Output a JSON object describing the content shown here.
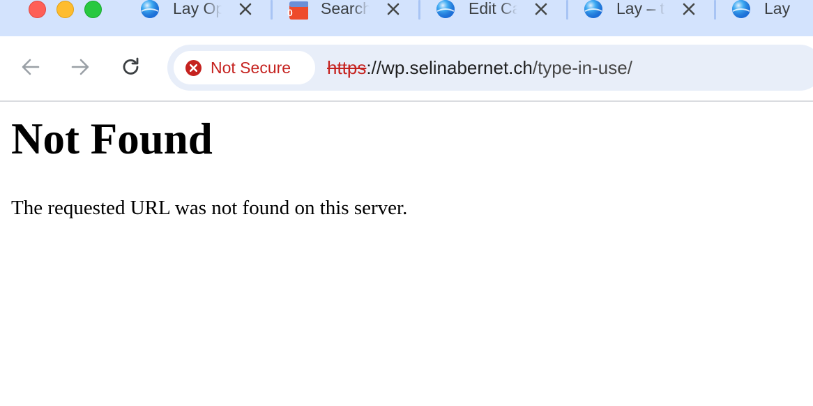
{
  "window": {
    "controls": [
      "close",
      "minimize",
      "maximize"
    ]
  },
  "tabs": [
    {
      "title": "Lay Op",
      "favicon": "globe-icon",
      "close_icon": "close-icon"
    },
    {
      "title": "Search",
      "favicon": "badge-app-icon",
      "close_icon": "close-icon"
    },
    {
      "title": "Edit Ca",
      "favicon": "globe-icon",
      "close_icon": "close-icon"
    },
    {
      "title": "Lay – t",
      "favicon": "globe-icon",
      "close_icon": "close-icon"
    },
    {
      "title": "Lay",
      "favicon": "globe-icon"
    }
  ],
  "toolbar": {
    "back_icon": "arrow-left-icon",
    "forward_icon": "arrow-right-icon",
    "reload_icon": "reload-icon"
  },
  "omnibox": {
    "security_label": "Not Secure",
    "security_icon": "error-x-icon",
    "url_scheme": "https",
    "url_separator": "://",
    "url_host": "wp.selinabernet.ch",
    "url_path": "/type-in-use/"
  },
  "page": {
    "heading": "Not Found",
    "message": "The requested URL was not found on this server."
  },
  "colors": {
    "tabstrip_bg": "#d3e3fd",
    "omnibox_bg": "#e8eef9",
    "insecure_red": "#c5221f",
    "traffic_close": "#fe5f57",
    "traffic_min": "#febc2e",
    "traffic_max": "#28c840"
  }
}
